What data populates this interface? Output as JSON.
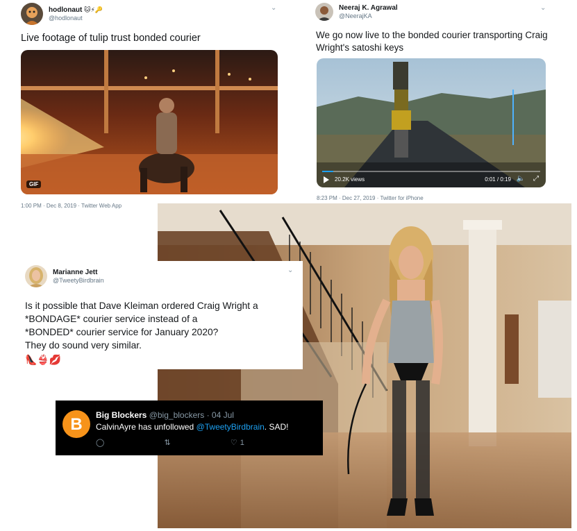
{
  "tweet1": {
    "display_name": "hodlonaut",
    "name_emoji": "🐱⚡🔑",
    "handle": "@hodlonaut",
    "text": "Live footage of tulip trust bonded courier",
    "gif_badge": "GIF",
    "meta": "1:00 PM · Dec 8, 2019 · Twitter Web App"
  },
  "tweet2": {
    "display_name": "Neeraj K. Agrawal",
    "handle": "@NeerajKA",
    "text": "We go now live to the bonded courier transporting Craig Wright's satoshi keys",
    "views": "20.2K views",
    "time": "0:01 / 0:19",
    "meta": "8:23 PM · Dec 27, 2019 · Twitter for iPhone"
  },
  "tweet3": {
    "display_name": "Marianne Jett",
    "handle": "@TweetyBirdbrain",
    "text_line1": "Is it possible that Dave Kleiman ordered Craig Wright a",
    "text_line2": "*BONDAGE* courier service instead of a",
    "text_line3": "*BONDED* courier service for January 2020?",
    "text_line4": "They do sound very similar.",
    "emoji": "👠👙💋"
  },
  "tweet4": {
    "display_name": "Big Blockers",
    "handle": "@big_blockers · 04 Jul",
    "action_user": "CalvinAyre",
    "action_text": "has unfollowed",
    "mention": "@TweetyBirdbrain",
    "suffix": ". SAD!",
    "like_count": "1"
  },
  "colors": {
    "twitter_blue": "#1da1f2",
    "bitcoin_orange": "#f7931a",
    "muted_text": "#657786"
  }
}
